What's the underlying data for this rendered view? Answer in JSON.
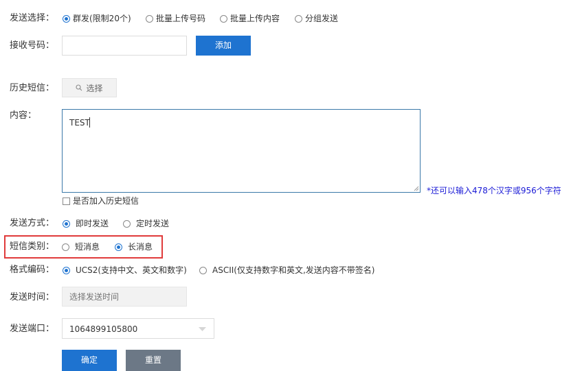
{
  "send_choice": {
    "label": "发送选择：",
    "options": [
      "群发(限制20个)",
      "批量上传号码",
      "批量上传内容",
      "分组发送"
    ],
    "selected": 0
  },
  "receiver": {
    "label": "接收号码：",
    "value": "",
    "add_label": "添加"
  },
  "history": {
    "label": "历史短信：",
    "select_label": "选择"
  },
  "content": {
    "label": "内容：",
    "value": "TEST",
    "hint": "*还可以输入478个汉字或956个字符",
    "add_history_label": "是否加入历史短信"
  },
  "send_mode": {
    "label": "发送方式：",
    "options": [
      "即时发送",
      "定时发送"
    ],
    "selected": 0
  },
  "sms_type": {
    "label": "短信类别：",
    "options": [
      "短消息",
      "长消息"
    ],
    "selected": 1
  },
  "encoding": {
    "label": "格式编码：",
    "options": [
      "UCS2(支持中文、英文和数字)",
      "ASCII(仅支持数字和英文,发送内容不带签名)"
    ],
    "selected": 0
  },
  "send_time": {
    "label": "发送时间：",
    "placeholder": "选择发送时间"
  },
  "send_port": {
    "label": "发送端口：",
    "value": "1064899105800"
  },
  "actions": {
    "confirm_label": "确定",
    "reset_label": "重置"
  },
  "colors": {
    "accent": "#1e73d0",
    "highlight_border": "#e03a3a",
    "hint_text": "#1a1ad6"
  }
}
